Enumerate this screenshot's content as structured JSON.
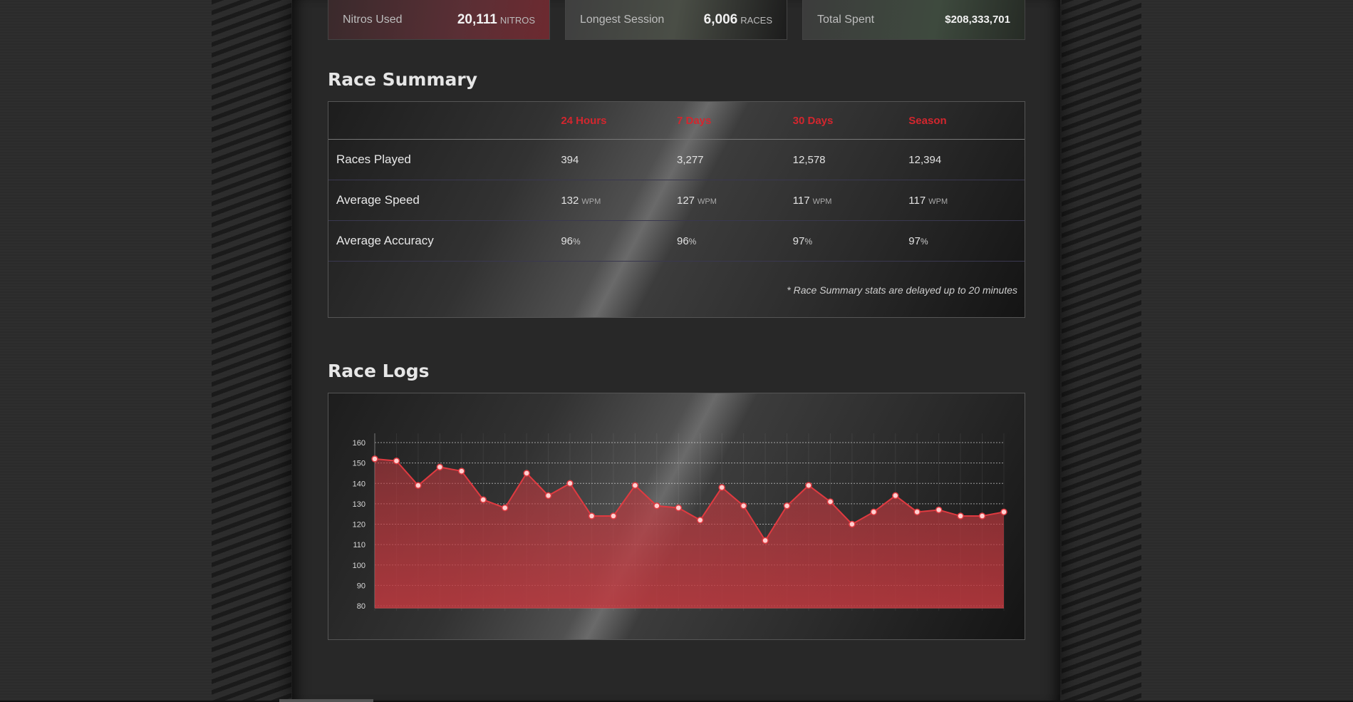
{
  "stats_cards": [
    {
      "label": "Nitros Used",
      "value": "20,111",
      "unit": "NITROS"
    },
    {
      "label": "Longest Session",
      "value": "6,006",
      "unit": "RACES"
    },
    {
      "label": "Total Spent",
      "value": "$208,333,701",
      "unit": ""
    }
  ],
  "race_summary": {
    "title": "Race Summary",
    "columns": [
      "24 Hours",
      "7 Days",
      "30 Days",
      "Season"
    ],
    "rows": [
      {
        "label": "Races Played",
        "values": [
          "394",
          "3,277",
          "12,578",
          "12,394"
        ],
        "unit": ""
      },
      {
        "label": "Average Speed",
        "values": [
          "132",
          "127",
          "117",
          "117"
        ],
        "unit": "WPM"
      },
      {
        "label": "Average Accuracy",
        "values": [
          "96",
          "96",
          "97",
          "97"
        ],
        "unit": "%"
      }
    ],
    "note": "* Race Summary stats are delayed up to 20 minutes"
  },
  "race_logs": {
    "title": "Race Logs"
  },
  "chart_data": {
    "type": "area",
    "title": "",
    "xlabel": "",
    "ylabel": "",
    "ylim": [
      80,
      160
    ],
    "yticks": [
      80,
      90,
      100,
      110,
      120,
      130,
      140,
      150,
      160
    ],
    "series": [
      {
        "values": [
          152,
          151,
          139,
          148,
          146,
          132,
          128,
          145,
          134,
          140,
          124,
          124,
          139,
          129,
          128,
          122,
          138,
          129,
          112,
          129,
          139,
          131,
          120,
          126,
          134,
          126,
          127,
          124,
          124,
          126
        ]
      }
    ],
    "colors": {
      "line": "#e03a40",
      "fill": "#c0393f",
      "point": "#ffd0d0"
    }
  }
}
